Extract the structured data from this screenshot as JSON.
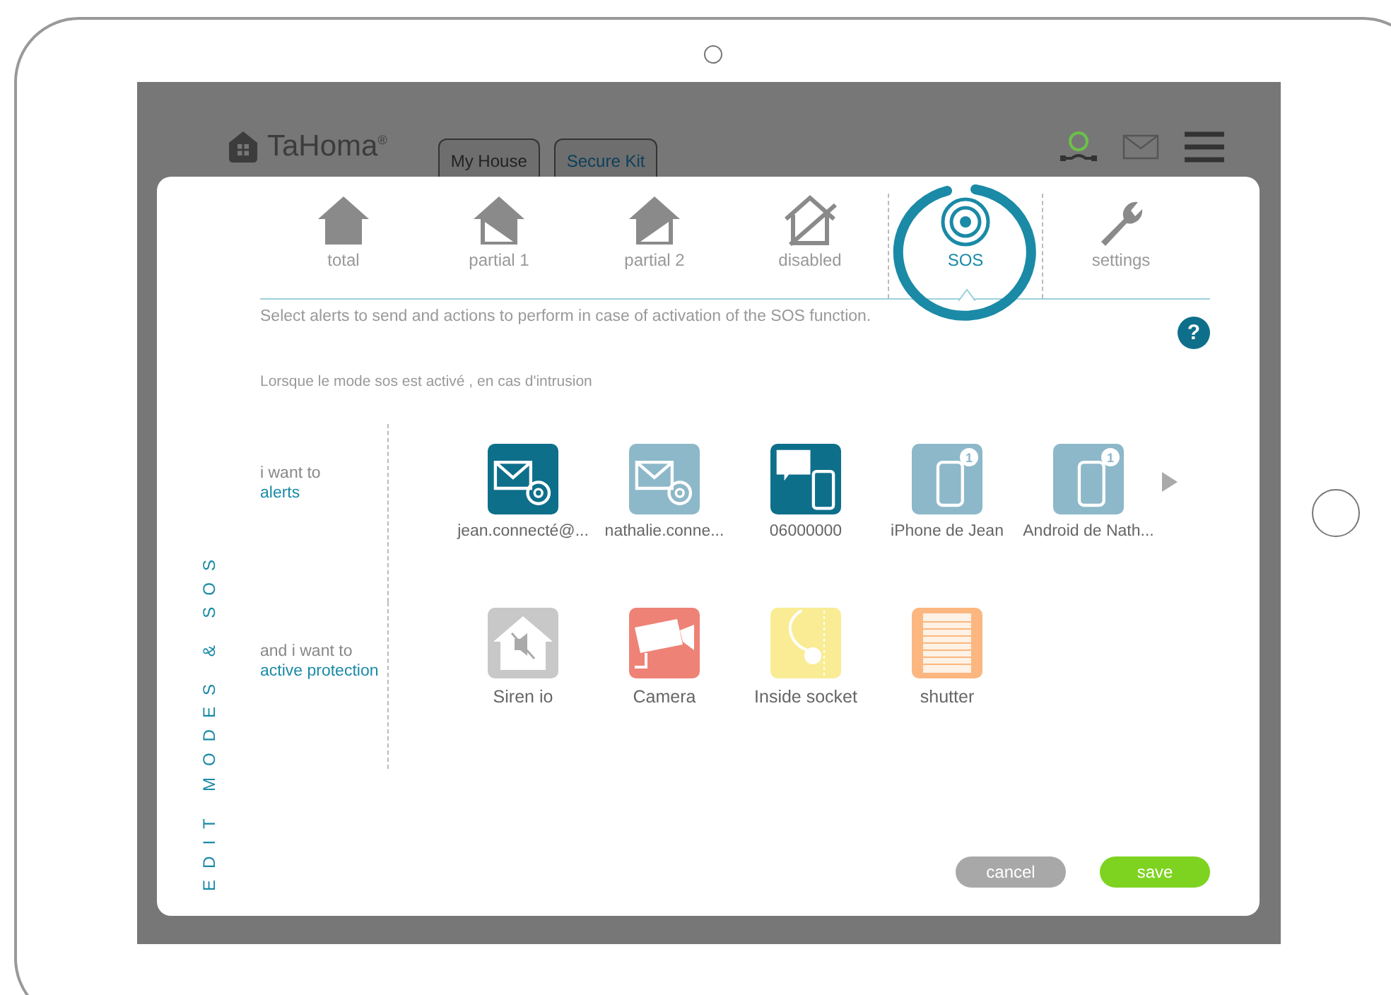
{
  "app": {
    "logo": "TaHoma",
    "logo_mark": "®",
    "tabs": [
      {
        "label": "My House",
        "selected": false
      },
      {
        "label": "Secure Kit",
        "selected": true
      }
    ]
  },
  "dialog": {
    "side_title": "EDIT MODES & SOS",
    "modes": [
      {
        "label": "total",
        "kind": "total",
        "selected": false
      },
      {
        "label": "partial 1",
        "kind": "partial1",
        "selected": false
      },
      {
        "label": "partial 2",
        "kind": "partial2",
        "selected": false
      },
      {
        "label": "disabled",
        "kind": "disabled",
        "selected": false
      },
      {
        "label": "SOS",
        "kind": "sos",
        "selected": true
      },
      {
        "label": "settings",
        "kind": "settings",
        "selected": false
      }
    ],
    "description": "Select alerts to send and actions to perform in case of activation of the SOS function.",
    "help": "?",
    "subtitle": "Lorsque le mode sos est activé , en cas d'intrusion",
    "alerts": {
      "label": "i want to",
      "action": "alerts",
      "items": [
        {
          "label": "jean.connecté@...",
          "kind": "email",
          "selected": true
        },
        {
          "label": "nathalie.conne...",
          "kind": "email",
          "selected": false
        },
        {
          "label": "06000000",
          "kind": "sms",
          "selected": true
        },
        {
          "label": "iPhone de Jean",
          "kind": "phone",
          "badge": "1",
          "selected": false
        },
        {
          "label": "Android de Nath...",
          "kind": "phone",
          "badge": "1",
          "selected": false
        }
      ]
    },
    "protection": {
      "label": "and i want to",
      "action": "active protection",
      "items": [
        {
          "label": "Siren io",
          "kind": "siren",
          "color": "#c8c8c8"
        },
        {
          "label": "Camera",
          "kind": "camera",
          "color": "#ee8277"
        },
        {
          "label": "Inside socket",
          "kind": "socket",
          "color": "#f9ec94"
        },
        {
          "label": "shutter",
          "kind": "shutter",
          "color": "#fbb77f"
        }
      ]
    },
    "buttons": [
      {
        "label": "cancel",
        "kind": "cancel"
      },
      {
        "label": "save",
        "kind": "save"
      }
    ]
  }
}
